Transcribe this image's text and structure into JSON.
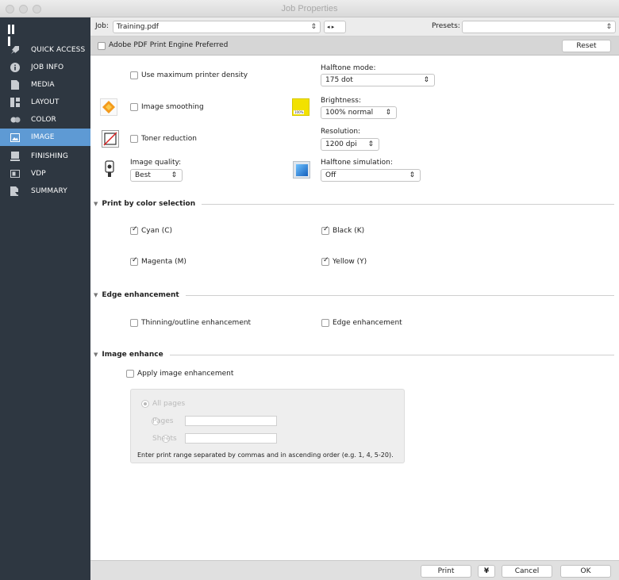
{
  "window": {
    "title": "Job Properties"
  },
  "sidebar": {
    "items": [
      {
        "label": "QUICK ACCESS",
        "icon": "rocket-icon"
      },
      {
        "label": "JOB INFO",
        "icon": "info-icon"
      },
      {
        "label": "MEDIA",
        "icon": "page-icon"
      },
      {
        "label": "LAYOUT",
        "icon": "layout-icon"
      },
      {
        "label": "COLOR",
        "icon": "palette-icon"
      },
      {
        "label": "IMAGE",
        "icon": "image-icon",
        "active": true
      },
      {
        "label": "FINISHING",
        "icon": "stack-icon"
      },
      {
        "label": "VDP",
        "icon": "vdp-icon"
      },
      {
        "label": "SUMMARY",
        "icon": "summary-icon"
      }
    ],
    "active_color": "#5e9ad4",
    "bg_color": "#2e3741"
  },
  "jobbar": {
    "job_label": "Job:",
    "job_value": "Training.pdf",
    "presets_label": "Presets:",
    "presets_value": ""
  },
  "engine": {
    "label": "Adobe PDF Print Engine Preferred",
    "checked": false,
    "reset_label": "Reset"
  },
  "image_settings": {
    "max_density_label": "Use maximum printer density",
    "smoothing_label": "Image smoothing",
    "toner_label": "Toner reduction",
    "quality_label": "Image quality:",
    "quality_value": "Best",
    "halftone_mode_label": "Halftone mode:",
    "halftone_mode_value": "175 dot",
    "brightness_label": "Brightness:",
    "brightness_value": "100% normal",
    "brightness_icon_text": "100%",
    "resolution_label": "Resolution:",
    "resolution_value": "1200 dpi",
    "halftone_sim_label": "Halftone simulation:",
    "halftone_sim_value": "Off"
  },
  "print_by_color": {
    "title": "Print by color selection",
    "cyan": "Cyan (C)",
    "black": "Black (K)",
    "magenta": "Magenta (M)",
    "yellow": "Yellow (Y)"
  },
  "edge": {
    "title": "Edge enhancement",
    "thinning": "Thinning/outline enhancement",
    "edge": "Edge enhancement"
  },
  "image_enhance": {
    "title": "Image enhance",
    "apply": "Apply image enhancement",
    "all_pages": "All pages",
    "pages": "Pages",
    "sheets": "Sheets",
    "hint": "Enter print range separated by commas and in ascending order (e.g. 1, 4, 5-20)."
  },
  "footer": {
    "print": "Print",
    "more": "¥",
    "cancel": "Cancel",
    "ok": "OK"
  }
}
